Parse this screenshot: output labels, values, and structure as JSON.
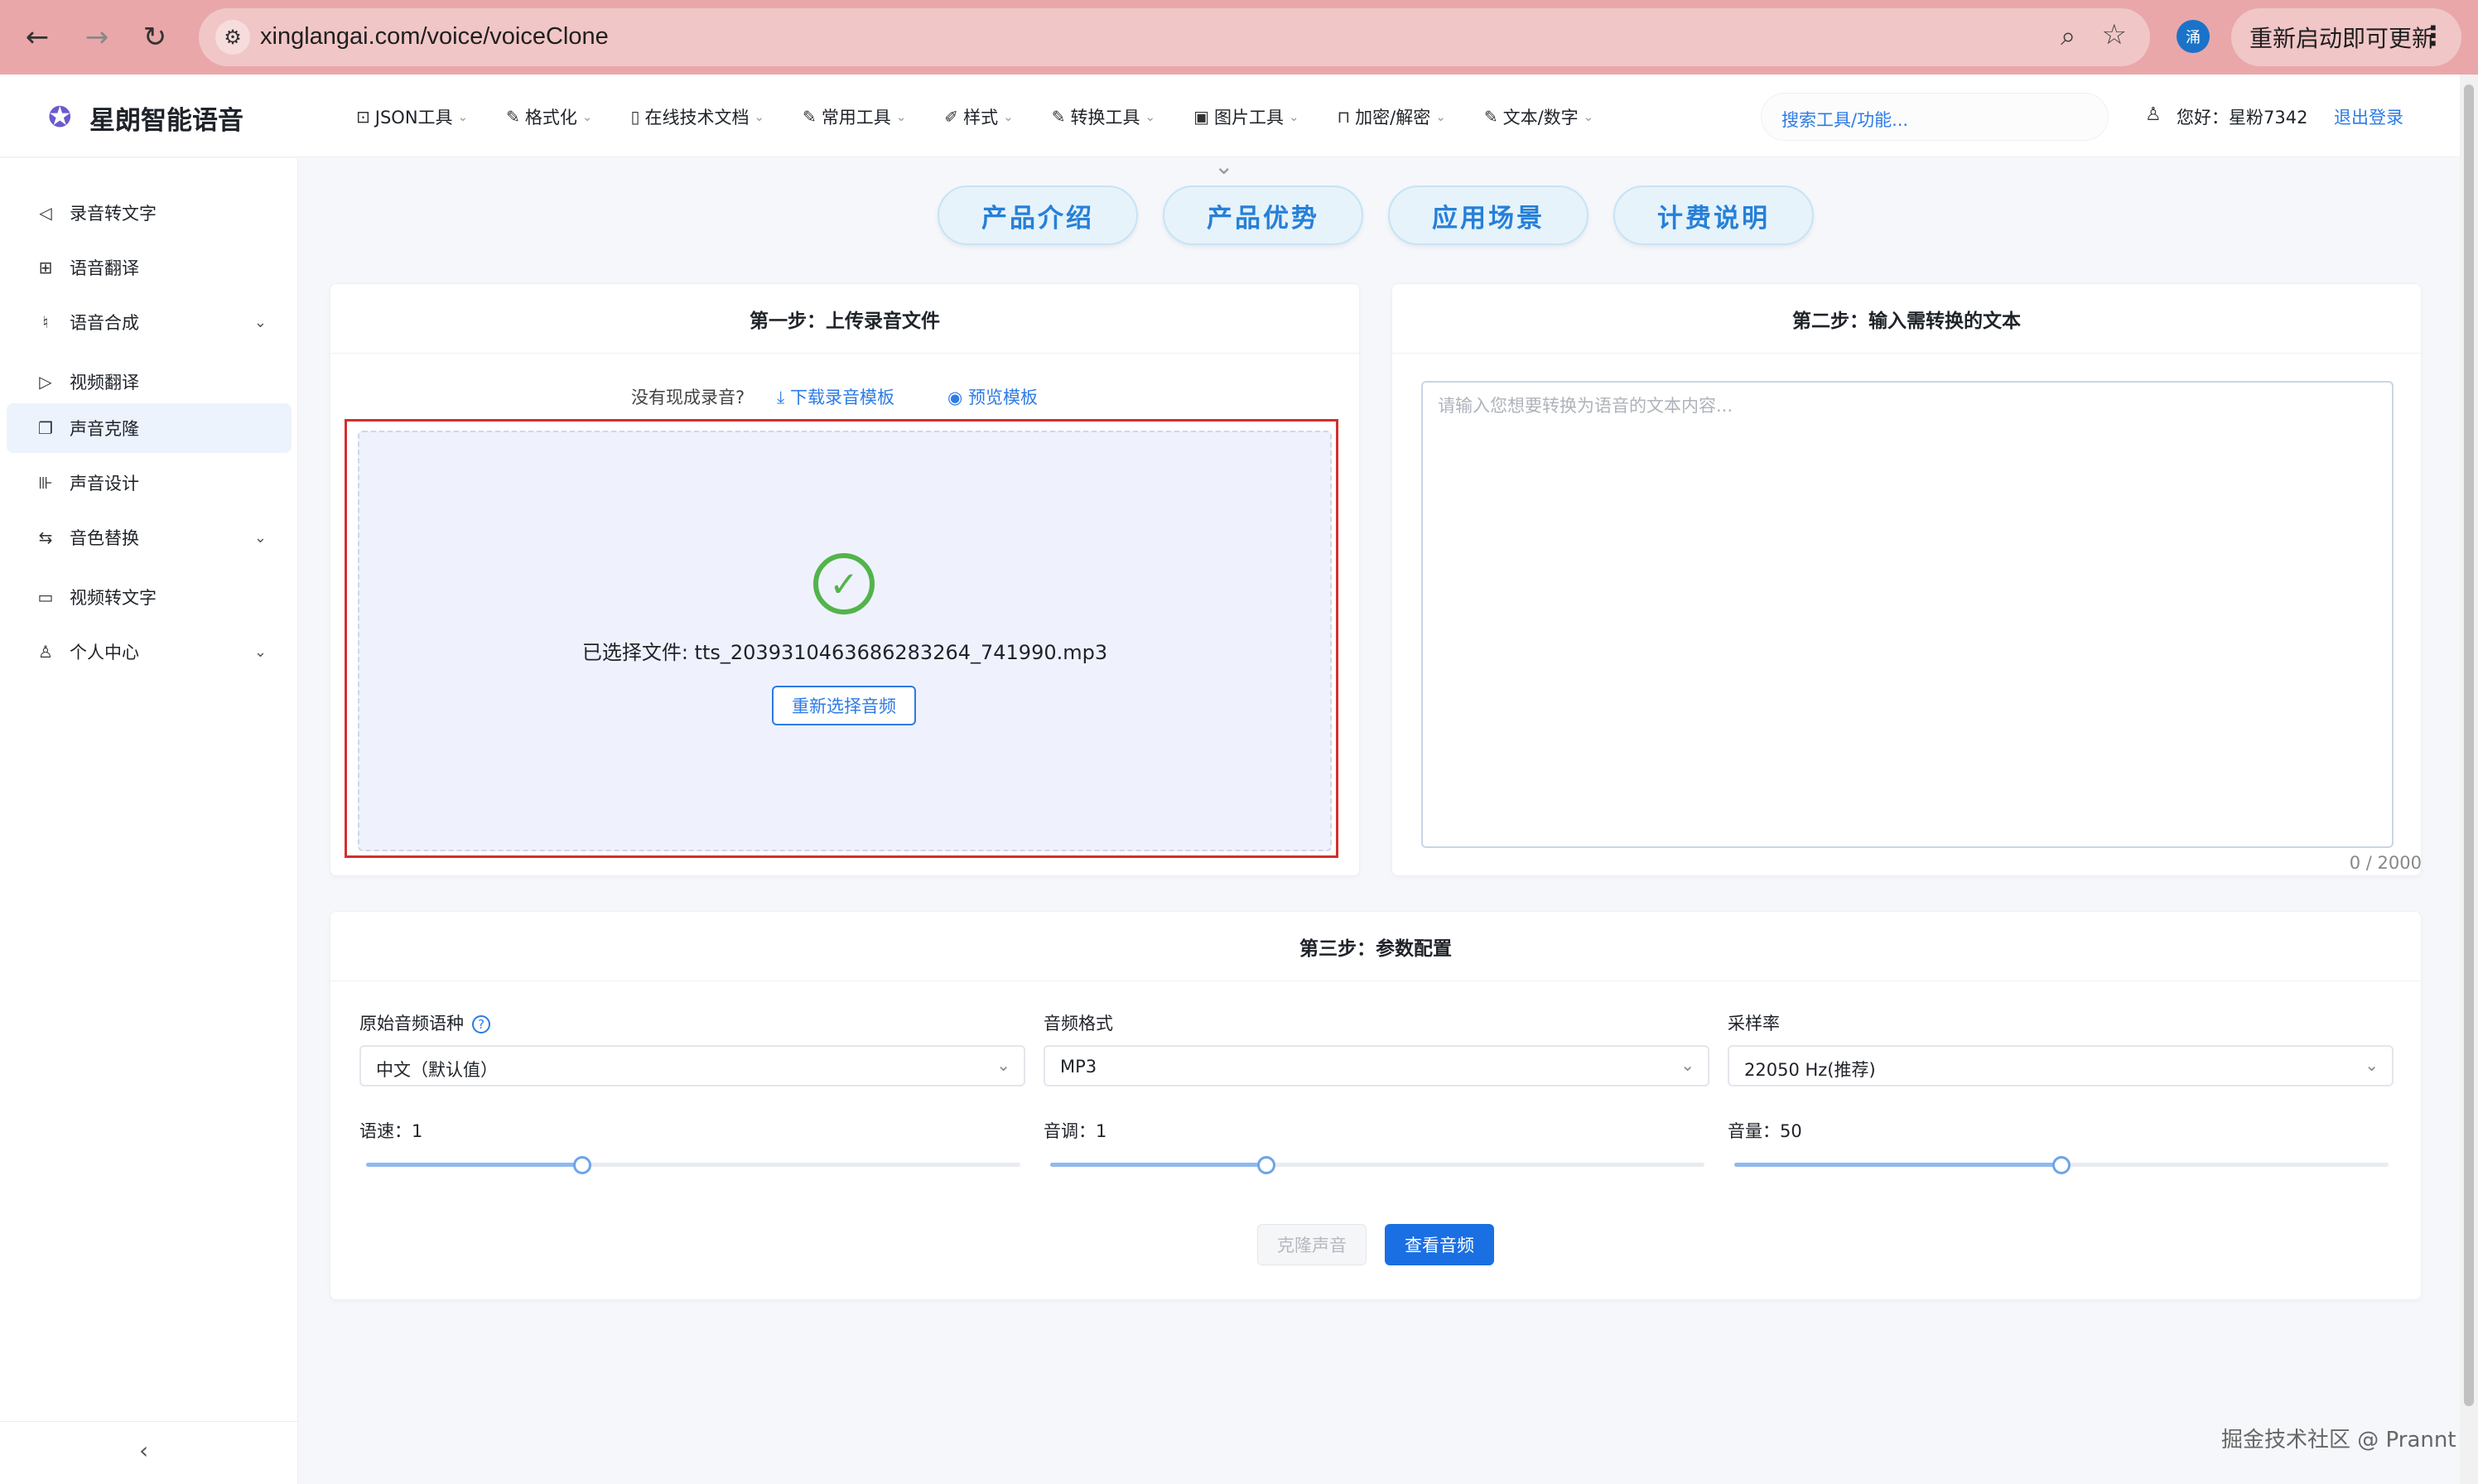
{
  "browser": {
    "url": "xinglangai.com/voice/voiceClone",
    "profile_initial": "涌",
    "update_label": "重新启动即可更新",
    "back_glyph": "←",
    "forward_glyph": "→",
    "reload_glyph": "↻",
    "site_info_glyph": "⚙",
    "zoom_glyph": "⌕",
    "star_glyph": "☆",
    "menu_glyph": "⋮"
  },
  "header": {
    "logo_glyph": "✪",
    "brand": "星朗智能语音",
    "nav": [
      {
        "label": "JSON工具",
        "icon": "terminal-icon",
        "glyph": "⊡"
      },
      {
        "label": "格式化",
        "icon": "edit-icon",
        "glyph": "✎"
      },
      {
        "label": "在线技术文档",
        "icon": "document-icon",
        "glyph": "▯"
      },
      {
        "label": "常用工具",
        "icon": "edit-icon",
        "glyph": "✎"
      },
      {
        "label": "样式",
        "icon": "brush-icon",
        "glyph": "✐"
      },
      {
        "label": "转换工具",
        "icon": "edit-icon",
        "glyph": "✎"
      },
      {
        "label": "图片工具",
        "icon": "image-icon",
        "glyph": "▣"
      },
      {
        "label": "加密/解密",
        "icon": "lock-icon",
        "glyph": "⊓"
      },
      {
        "label": "文本/数字",
        "icon": "edit-icon",
        "glyph": "✎"
      }
    ],
    "chevron_glyph": "⌄",
    "search_placeholder": "搜索工具/功能...",
    "user_glyph": "♙",
    "greeting": "您好：星粉7342",
    "logout": "退出登录"
  },
  "sidebar": {
    "items": [
      {
        "label": "录音转文字",
        "icon": "speaker-icon",
        "glyph": "◁",
        "expandable": false,
        "active": false
      },
      {
        "label": "语音翻译",
        "icon": "translate-icon",
        "glyph": "⊞",
        "expandable": false,
        "active": false
      },
      {
        "label": "语音合成",
        "icon": "microphone-icon",
        "glyph": "♮",
        "expandable": true,
        "active": false
      },
      {
        "label": "视频翻译",
        "icon": "play-icon",
        "glyph": "▷",
        "expandable": false,
        "active": false
      },
      {
        "label": "声音克隆",
        "icon": "copy-icon",
        "glyph": "❐",
        "expandable": false,
        "active": true
      },
      {
        "label": "声音设计",
        "icon": "equalizer-icon",
        "glyph": "⊪",
        "expandable": false,
        "active": false
      },
      {
        "label": "音色替换",
        "icon": "swap-icon",
        "glyph": "⇆",
        "expandable": true,
        "active": false
      },
      {
        "label": "视频转文字",
        "icon": "video-icon",
        "glyph": "▭",
        "expandable": false,
        "active": false
      },
      {
        "label": "个人中心",
        "icon": "user-icon",
        "glyph": "♙",
        "expandable": true,
        "active": false
      }
    ],
    "chevron_glyph": "⌄",
    "collapse_glyph": "‹"
  },
  "tabs": [
    "产品介绍",
    "产品优势",
    "应用场景",
    "计费说明"
  ],
  "tabs_caret": "⌄",
  "step1": {
    "title": "第一步：上传录音文件",
    "hint": "没有现成录音?",
    "download_link": "下载录音模板",
    "download_glyph": "⤓",
    "preview_link": "预览模板",
    "preview_glyph": "◉",
    "check_glyph": "✓",
    "file_label": "已选择文件: tts_2039310463686283264_741990.mp3",
    "reselect_button": "重新选择音频"
  },
  "step2": {
    "title": "第二步：输入需转换的文本",
    "placeholder": "请输入您想要转换为语音的文本内容...",
    "counter": "0 / 2000"
  },
  "step3": {
    "title": "第三步：参数配置",
    "help_glyph": "?",
    "caret_glyph": "⌄",
    "language_label": "原始音频语种",
    "language_value": "中文（默认值）",
    "format_label": "音频格式",
    "format_value": "MP3",
    "sample_rate_label": "采样率",
    "sample_rate_value": "22050 Hz(推荐)",
    "speed_label": "语速：1",
    "speed_fraction": 0.33,
    "pitch_label": "音调：1",
    "pitch_fraction": 0.33,
    "volume_label": "音量：50",
    "volume_fraction": 0.5,
    "clone_button": "克隆声音",
    "view_button": "查看音频"
  },
  "watermark": "掘金技术社区 @ Prannt",
  "colors": {
    "browser_bar": "#e9a7a9",
    "accent": "#2d7be5",
    "primary_button": "#1a6fe3",
    "success": "#52b44b",
    "highlight_box": "#d32f2f"
  }
}
